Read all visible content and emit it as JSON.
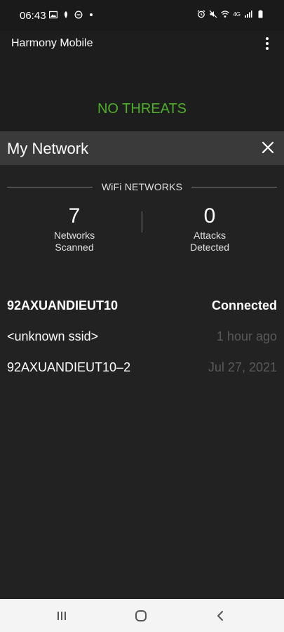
{
  "status_bar": {
    "time": "06:43",
    "network_type": "4G"
  },
  "app": {
    "title": "Harmony Mobile",
    "threat_status": "NO THREATS",
    "threat_color": "#4caf2a"
  },
  "my_network": {
    "title": "My Network",
    "section_label": "WiFi NETWORKS",
    "stats": [
      {
        "value": "7",
        "label_line1": "Networks",
        "label_line2": "Scanned"
      },
      {
        "value": "0",
        "label_line1": "Attacks",
        "label_line2": "Detected"
      }
    ],
    "networks": [
      {
        "name": "92AXUANDIEUT10",
        "status": "Connected"
      },
      {
        "name": "<unknown ssid>",
        "status": "1 hour ago"
      },
      {
        "name": "92AXUANDIEUT10–2",
        "status": "Jul 27, 2021"
      }
    ]
  },
  "icons": {
    "menu": "more-vert-icon",
    "close": "close-icon",
    "nav_recents": "recents-icon",
    "nav_home": "home-icon",
    "nav_back": "back-icon"
  }
}
